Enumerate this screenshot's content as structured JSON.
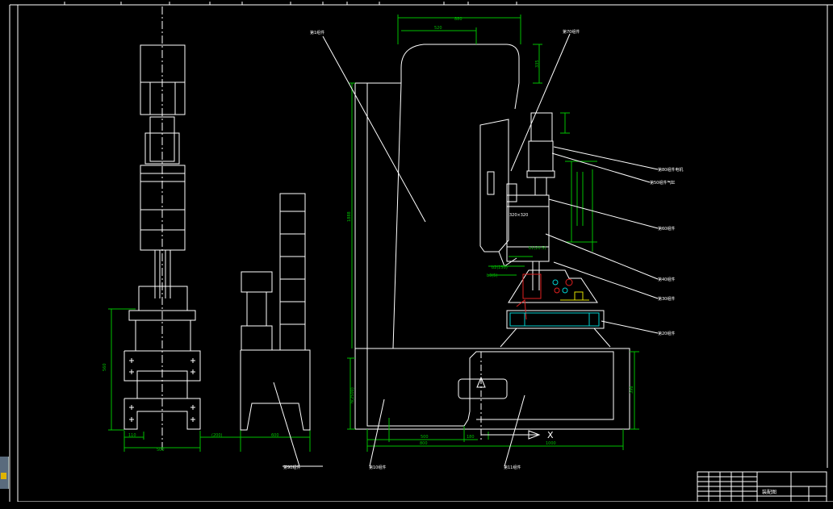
{
  "drawing": {
    "annotations": {
      "column": "第1组件",
      "spindle": "第70组件",
      "motor": "第80组件电机",
      "cylinder": "第50组件气缸",
      "reducer": "第60组件",
      "head": "第40组件",
      "clamp": "第30组件",
      "fixture": "第20组件",
      "table": "第10组件",
      "base": "第11组件",
      "side_unit": "第90组件"
    },
    "dimensions": {
      "top_total": "880",
      "top_inner": "520",
      "head_height": "335",
      "overall_height": "1888",
      "base_height": "h(2500)",
      "right_height": "398",
      "bottom_left_a": "500",
      "bottom_left_b": "180",
      "bottom_total_left": "800",
      "bottom_total_right": "1000",
      "left_width": "500",
      "left_sub": "110",
      "left_side": "(200)",
      "left_height": "560",
      "mid_width": "600",
      "spindle_box": "320×320",
      "offset_a": "b1(20.5)",
      "offset_b": "b2(250)",
      "offset_c": "b3(5)",
      "axis": "X"
    }
  },
  "title_block": {
    "label": "装配图"
  }
}
